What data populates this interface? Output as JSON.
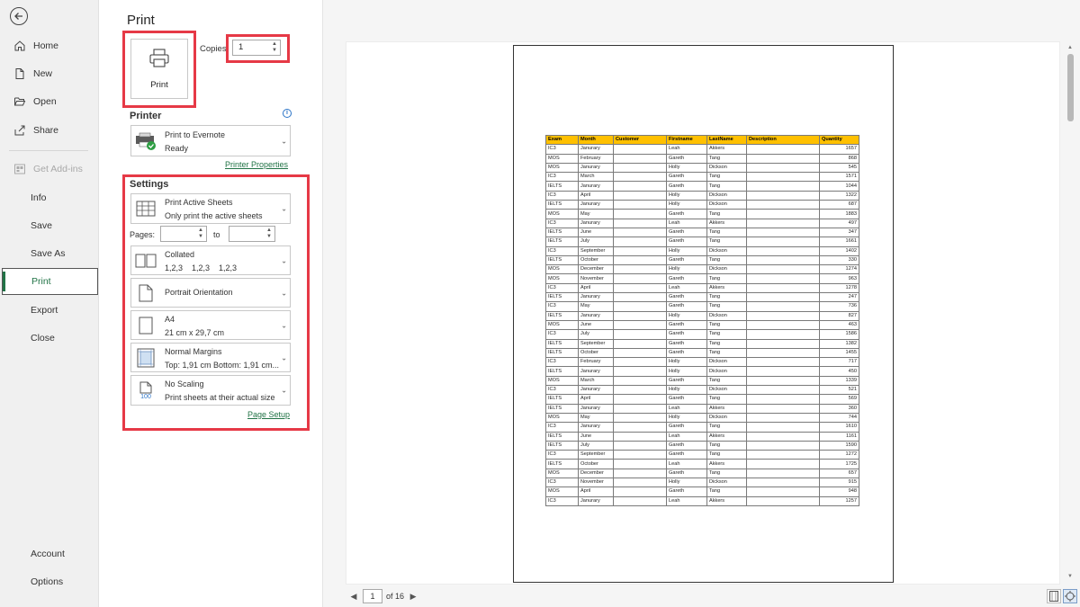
{
  "nav": {
    "items": [
      {
        "label": "Home",
        "icon": "home-icon"
      },
      {
        "label": "New",
        "icon": "new-document-icon"
      },
      {
        "label": "Open",
        "icon": "open-folder-icon"
      },
      {
        "label": "Share",
        "icon": "share-icon"
      },
      {
        "label": "Get Add-ins",
        "icon": "add-ins-icon"
      },
      {
        "label": "Info"
      },
      {
        "label": "Save"
      },
      {
        "label": "Save As"
      },
      {
        "label": "Print"
      },
      {
        "label": "Export"
      },
      {
        "label": "Close"
      },
      {
        "label": "Account"
      },
      {
        "label": "Options"
      }
    ]
  },
  "print": {
    "title": "Print",
    "button_label": "Print",
    "copies_label": "Copies:",
    "copies_value": "1"
  },
  "printer": {
    "section_title": "Printer",
    "name": "Print to Evernote",
    "status": "Ready",
    "properties_link": "Printer Properties"
  },
  "settings": {
    "section_title": "Settings",
    "sheets": {
      "line1": "Print Active Sheets",
      "line2": "Only print the active sheets"
    },
    "pages_label": "Pages:",
    "to_label": "to",
    "collated": {
      "line1": "Collated",
      "line2": "1,2,3    1,2,3    1,2,3"
    },
    "orientation": {
      "line1": "Portrait Orientation"
    },
    "paper": {
      "line1": "A4",
      "line2": "21 cm x 29,7 cm"
    },
    "margins": {
      "line1": "Normal Margins",
      "line2": "Top: 1,91 cm Bottom: 1,91 cm..."
    },
    "scaling": {
      "line1": "No Scaling",
      "line2": "Print sheets at their actual size",
      "icon_text": "100"
    },
    "page_setup_link": "Page Setup"
  },
  "preview": {
    "columns": [
      "Exam",
      "Month",
      "Customer",
      "Firstname",
      "LastName",
      "Description",
      "Quantity"
    ],
    "rows": [
      [
        "IC3",
        "Janurary",
        "",
        "Leah",
        "Akkers",
        "",
        "1657"
      ],
      [
        "MOS",
        "February",
        "",
        "Gareth",
        "Tang",
        "",
        "868"
      ],
      [
        "MOS",
        "Janurary",
        "",
        "Holly",
        "Dickson",
        "",
        "545"
      ],
      [
        "IC3",
        "March",
        "",
        "Gareth",
        "Tang",
        "",
        "1571"
      ],
      [
        "IELTS",
        "Janurary",
        "",
        "Gareth",
        "Tang",
        "",
        "1044"
      ],
      [
        "IC3",
        "April",
        "",
        "Holly",
        "Dickson",
        "",
        "1322"
      ],
      [
        "IELTS",
        "Janurary",
        "",
        "Holly",
        "Dickson",
        "",
        "687"
      ],
      [
        "MOS",
        "May",
        "",
        "Gareth",
        "Tang",
        "",
        "1883"
      ],
      [
        "IC3",
        "Janurary",
        "",
        "Leah",
        "Akkers",
        "",
        "497"
      ],
      [
        "IELTS",
        "June",
        "",
        "Gareth",
        "Tang",
        "",
        "347"
      ],
      [
        "IELTS",
        "July",
        "",
        "Gareth",
        "Tang",
        "",
        "1661"
      ],
      [
        "IC3",
        "September",
        "",
        "Holly",
        "Dickson",
        "",
        "1402"
      ],
      [
        "IELTS",
        "October",
        "",
        "Gareth",
        "Tang",
        "",
        "330"
      ],
      [
        "MOS",
        "December",
        "",
        "Holly",
        "Dickson",
        "",
        "1274"
      ],
      [
        "MOS",
        "November",
        "",
        "Gareth",
        "Tang",
        "",
        "963"
      ],
      [
        "IC3",
        "April",
        "",
        "Leah",
        "Akkers",
        "",
        "1278"
      ],
      [
        "IELTS",
        "Janurary",
        "",
        "Gareth",
        "Tang",
        "",
        "247"
      ],
      [
        "IC3",
        "May",
        "",
        "Gareth",
        "Tang",
        "",
        "736"
      ],
      [
        "IELTS",
        "Janurary",
        "",
        "Holly",
        "Dickson",
        "",
        "827"
      ],
      [
        "MOS",
        "June",
        "",
        "Gareth",
        "Tang",
        "",
        "463"
      ],
      [
        "IC3",
        "July",
        "",
        "Gareth",
        "Tang",
        "",
        "1586"
      ],
      [
        "IELTS",
        "September",
        "",
        "Gareth",
        "Tang",
        "",
        "1382"
      ],
      [
        "IELTS",
        "October",
        "",
        "Gareth",
        "Tang",
        "",
        "1455"
      ],
      [
        "IC3",
        "February",
        "",
        "Holly",
        "Dickson",
        "",
        "717"
      ],
      [
        "IELTS",
        "Janurary",
        "",
        "Holly",
        "Dickson",
        "",
        "450"
      ],
      [
        "MOS",
        "March",
        "",
        "Gareth",
        "Tang",
        "",
        "1339"
      ],
      [
        "IC3",
        "Janurary",
        "",
        "Holly",
        "Dickson",
        "",
        "521"
      ],
      [
        "IELTS",
        "April",
        "",
        "Gareth",
        "Tang",
        "",
        "569"
      ],
      [
        "IELTS",
        "Janurary",
        "",
        "Leah",
        "Akkers",
        "",
        "360"
      ],
      [
        "MOS",
        "May",
        "",
        "Holly",
        "Dickson",
        "",
        "744"
      ],
      [
        "IC3",
        "Janurary",
        "",
        "Gareth",
        "Tang",
        "",
        "1610"
      ],
      [
        "IELTS",
        "June",
        "",
        "Leah",
        "Akkers",
        "",
        "1161"
      ],
      [
        "IELTS",
        "July",
        "",
        "Gareth",
        "Tang",
        "",
        "1590"
      ],
      [
        "IC3",
        "September",
        "",
        "Gareth",
        "Tang",
        "",
        "1272"
      ],
      [
        "IELTS",
        "October",
        "",
        "Leah",
        "Akkers",
        "",
        "1725"
      ],
      [
        "MOS",
        "December",
        "",
        "Gareth",
        "Tang",
        "",
        "657"
      ],
      [
        "IC3",
        "November",
        "",
        "Holly",
        "Dickson",
        "",
        "915"
      ],
      [
        "MOS",
        "April",
        "",
        "Gareth",
        "Tang",
        "",
        "948"
      ],
      [
        "IC3",
        "Janurary",
        "",
        "Leah",
        "Akkers",
        "",
        "1257"
      ]
    ],
    "current_page": "1",
    "of_label": "of 16"
  },
  "colors": {
    "accent": "#217346",
    "highlight": "#e63946",
    "header_fill": "#ffc000"
  }
}
